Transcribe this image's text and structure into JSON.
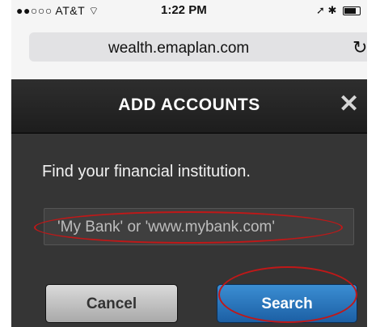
{
  "status_bar": {
    "carrier": "●●○○○ AT&T",
    "wifi_icon": "wifi-icon",
    "time": "1:22 PM",
    "location_icon": "arrow-icon",
    "bluetooth_icon": "bluetooth-icon",
    "battery_level": 0.7
  },
  "browser": {
    "url": "wealth.emaplan.com",
    "reload_icon": "reload-icon"
  },
  "modal": {
    "title": "ADD ACCOUNTS",
    "close_icon": "close-icon",
    "prompt": "Find your financial institution.",
    "search_placeholder": "'My Bank' or 'www.mybank.com'",
    "cancel_label": "Cancel",
    "search_label": "Search"
  },
  "annotations": {
    "highlight_color": "#c01818"
  }
}
